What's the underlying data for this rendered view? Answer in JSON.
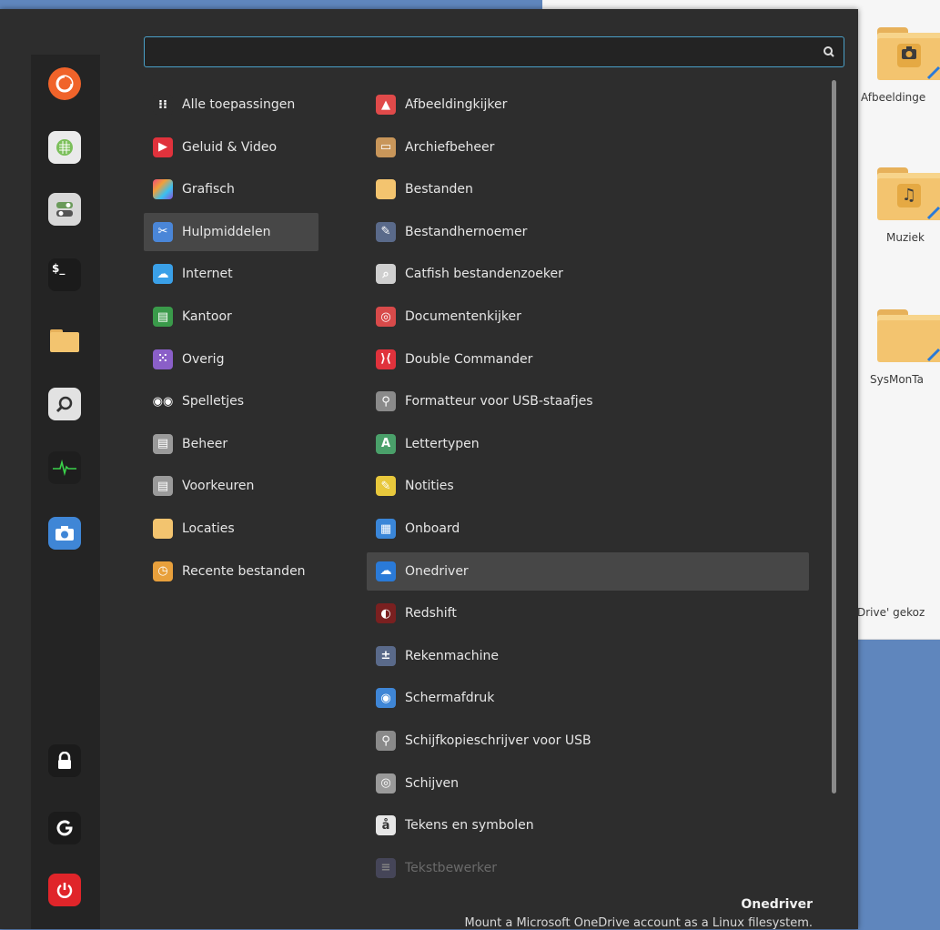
{
  "desktop": {
    "background": "#5f86bd"
  },
  "file_manager": {
    "items": [
      {
        "label": "Afbeeldinge",
        "emblem": "camera-icon"
      },
      {
        "label": "Muziek",
        "emblem": "music-note-icon"
      },
      {
        "label": "SysMonTa",
        "emblem": ""
      }
    ],
    "status": "Drive' gekoz"
  },
  "menu": {
    "search": {
      "value": "",
      "placeholder": ""
    },
    "favorites": [
      {
        "name": "firefox",
        "icon": "firefox-icon",
        "color": "#f0632a"
      },
      {
        "name": "spreadsheet",
        "icon": "spreadsheet-icon",
        "color": "#7bbf5a"
      },
      {
        "name": "settings",
        "icon": "settings-icon",
        "color": "#9bbf8a"
      },
      {
        "name": "terminal",
        "icon": "terminal-icon",
        "color": "#1e1e1e"
      },
      {
        "name": "files",
        "icon": "folder-icon",
        "color": "#f3c46f"
      },
      {
        "name": "catfish",
        "icon": "search-tool-icon",
        "color": "#cfcfcf"
      },
      {
        "name": "system-monitor",
        "icon": "system-monitor-icon",
        "color": "#1e1e1e"
      },
      {
        "name": "screenshot",
        "icon": "camera-icon",
        "color": "#3f86d6"
      }
    ],
    "session_buttons": [
      {
        "name": "lock",
        "icon": "lock-icon"
      },
      {
        "name": "logout",
        "icon": "logout-icon"
      },
      {
        "name": "shutdown",
        "icon": "power-icon"
      }
    ],
    "categories": [
      {
        "label": "Alle toepassingen",
        "icon": "grid-icon",
        "color": "#2d2d2d"
      },
      {
        "label": "Geluid & Video",
        "icon": "play-icon",
        "color": "#e0323c"
      },
      {
        "label": "Grafisch",
        "icon": "graphics-icon",
        "color": "#8a4fd6"
      },
      {
        "label": "Hulpmiddelen",
        "icon": "accessories-icon",
        "color": "#4a86d8",
        "selected": true
      },
      {
        "label": "Internet",
        "icon": "cloud-icon",
        "color": "#3aa0e8"
      },
      {
        "label": "Kantoor",
        "icon": "office-icon",
        "color": "#3a9a4a"
      },
      {
        "label": "Overig",
        "icon": "other-icon",
        "color": "#8a5fc8"
      },
      {
        "label": "Spelletjes",
        "icon": "gamepad-icon",
        "color": "#2d2d2d"
      },
      {
        "label": "Beheer",
        "icon": "admin-icon",
        "color": "#9a9a9a"
      },
      {
        "label": "Voorkeuren",
        "icon": "preferences-icon",
        "color": "#9a9a9a"
      },
      {
        "label": "Locaties",
        "icon": "folder-icon",
        "color": "#f3c46f"
      },
      {
        "label": "Recente bestanden",
        "icon": "recent-icon",
        "color": "#e8a03c"
      }
    ],
    "apps": [
      {
        "label": "Afbeeldingkijker",
        "icon": "image-viewer-icon",
        "color": "#e04a4a"
      },
      {
        "label": "Archiefbeheer",
        "icon": "archive-icon",
        "color": "#c8965a"
      },
      {
        "label": "Bestanden",
        "icon": "folder-icon",
        "color": "#f3c46f"
      },
      {
        "label": "Bestandhernoemer",
        "icon": "rename-icon",
        "color": "#5a6a8a"
      },
      {
        "label": "Catfish bestandenzoeker",
        "icon": "search-tool-icon",
        "color": "#cfcfcf"
      },
      {
        "label": "Documentenkijker",
        "icon": "document-viewer-icon",
        "color": "#d84a4a"
      },
      {
        "label": "Double Commander",
        "icon": "double-commander-icon",
        "color": "#e0323c"
      },
      {
        "label": "Formatteur voor USB-staafjes",
        "icon": "usb-icon",
        "color": "#8a8a8a"
      },
      {
        "label": "Lettertypen",
        "icon": "fonts-icon",
        "color": "#4aa06a"
      },
      {
        "label": "Notities",
        "icon": "notes-icon",
        "color": "#e8c83c"
      },
      {
        "label": "Onboard",
        "icon": "keyboard-icon",
        "color": "#3a86d8"
      },
      {
        "label": "Onedriver",
        "icon": "onedrive-icon",
        "color": "#2a7ad8",
        "selected": true
      },
      {
        "label": "Redshift",
        "icon": "redshift-icon",
        "color": "#7a2020"
      },
      {
        "label": "Rekenmachine",
        "icon": "calculator-icon",
        "color": "#5a6a8a"
      },
      {
        "label": "Schermafdruk",
        "icon": "camera-icon",
        "color": "#3f86d6"
      },
      {
        "label": "Schijfkopieschrijver voor USB",
        "icon": "usb-icon",
        "color": "#8a8a8a"
      },
      {
        "label": "Schijven",
        "icon": "disks-icon",
        "color": "#9a9a9a"
      },
      {
        "label": "Tekens en symbolen",
        "icon": "characters-icon",
        "color": "#e6e6e6"
      },
      {
        "label": "Tekstbewerker",
        "icon": "text-editor-icon",
        "color": "#6a6a9a",
        "dim": true
      }
    ],
    "description": {
      "title": "Onedriver",
      "text": "Mount a Microsoft OneDrive account as a Linux filesystem."
    }
  }
}
